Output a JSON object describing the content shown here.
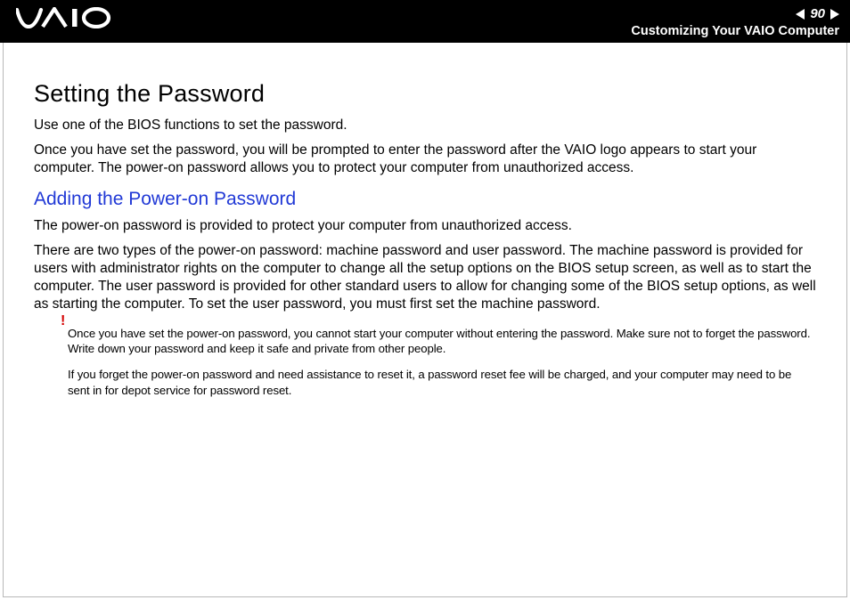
{
  "header": {
    "page_number": "90",
    "subtitle": "Customizing Your VAIO Computer"
  },
  "content": {
    "h1": "Setting the Password",
    "p1": "Use one of the BIOS functions to set the password.",
    "p2": "Once you have set the password, you will be prompted to enter the password after the VAIO logo appears to start your computer. The power-on password allows you to protect your computer from unauthorized access.",
    "h2": "Adding the Power-on Password",
    "p3": "The power-on password is provided to protect your computer from unauthorized access.",
    "p4": "There are two types of the power-on password: machine password and user password. The machine password is provided for users with administrator rights on the computer to change all the setup options on the BIOS setup screen, as well as to start the computer. The user password is provided for other standard users to allow for changing some of the BIOS setup options, as well as starting the computer. To set the user password, you must first set the machine password.",
    "excl": "!",
    "note1": "Once you have set the power-on password, you cannot start your computer without entering the password. Make sure not to forget the password. Write down your password and keep it safe and private from other people.",
    "note2": "If you forget the power-on password and need assistance to reset it, a password reset fee will be charged, and your computer may need to be sent in for depot service for password reset."
  }
}
